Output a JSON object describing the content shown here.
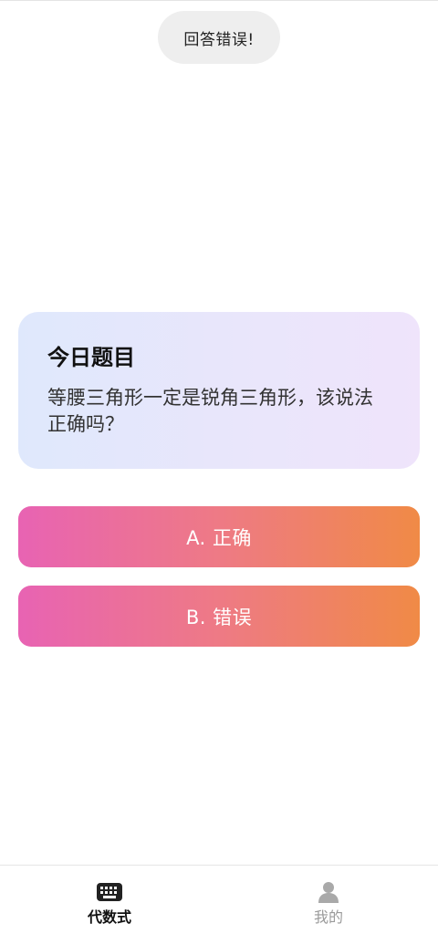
{
  "toast": {
    "text": "回答错误!"
  },
  "card": {
    "title": "今日题目",
    "question": "等腰三角形一定是锐角三角形，该说法正确吗？"
  },
  "options": [
    {
      "label": "A. 正确"
    },
    {
      "label": "B. 错误"
    }
  ],
  "tabbar": {
    "items": [
      {
        "label": "代数式",
        "icon": "keyboard-icon",
        "active": true
      },
      {
        "label": "我的",
        "icon": "person-icon",
        "active": false
      }
    ]
  },
  "colors": {
    "option_gradient_start": "#e863b3",
    "option_gradient_end": "#f08a46",
    "card_gradient_start": "#dfe8fc",
    "card_gradient_end": "#efe4fb",
    "tab_active": "#111111",
    "tab_inactive": "#9a9a9a"
  }
}
